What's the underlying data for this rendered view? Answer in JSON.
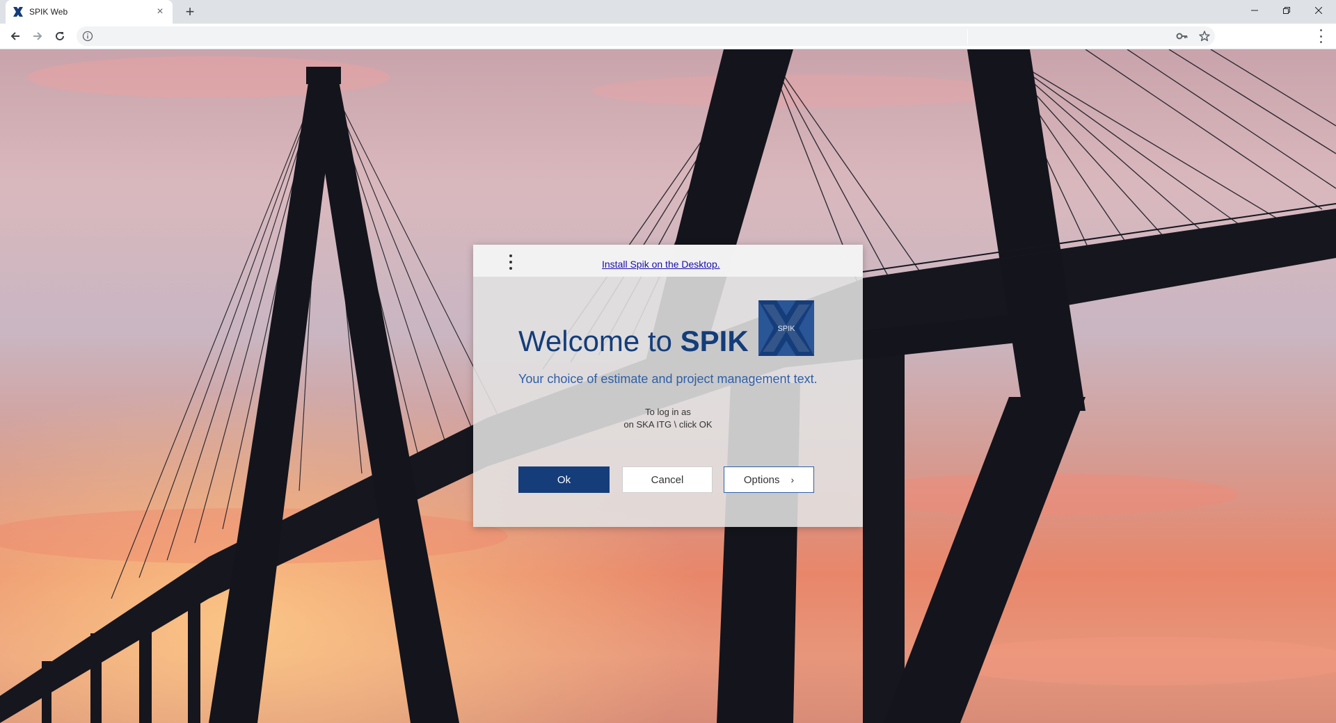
{
  "browser": {
    "tab_title": "SPIK Web",
    "tab_close": "×",
    "new_tab": "+",
    "address_value": ""
  },
  "dialog": {
    "install_link": "Install Spik on the Desktop.",
    "welcome_prefix": "Welcome to",
    "welcome_brand": "SPIK",
    "logo_text": "SPIK",
    "subtitle": "Your choice of estimate and project management text.",
    "login_line1": "To log in as",
    "login_line2": "on SKA ITG \\ click OK",
    "ok_label": "Ok",
    "cancel_label": "Cancel",
    "options_label": "Options",
    "options_chevron": "›"
  },
  "colors": {
    "brand_blue": "#153d7a",
    "link": "#1a0dab"
  },
  "icons": [
    "spik-favicon-icon",
    "close-icon",
    "new-tab-icon",
    "minimize-icon",
    "restore-icon",
    "window-close-icon",
    "back-icon",
    "forward-icon",
    "reload-icon",
    "info-icon",
    "key-icon",
    "star-icon",
    "menu-icon",
    "kebab-menu-icon",
    "spik-logo-icon",
    "chevron-right-icon"
  ]
}
